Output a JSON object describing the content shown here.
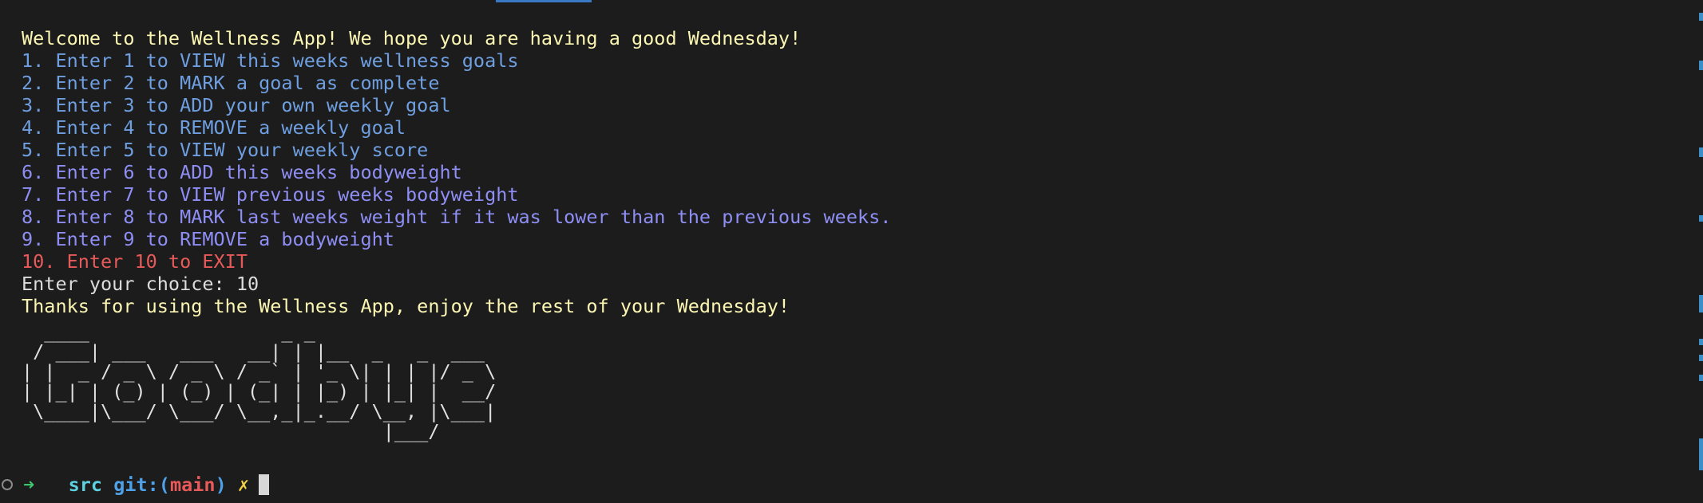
{
  "terminal": {
    "lines": [
      {
        "text": "Welcome to the Wellness App! We hope you are having a good Wednesday!"
      },
      {
        "text": "1. Enter 1 to VIEW this weeks wellness goals"
      },
      {
        "text": "2. Enter 2 to MARK a goal as complete"
      },
      {
        "text": "3. Enter 3 to ADD your own weekly goal"
      },
      {
        "text": "4. Enter 4 to REMOVE a weekly goal"
      },
      {
        "text": "5. Enter 5 to VIEW your weekly score"
      },
      {
        "text": "6. Enter 6 to ADD this weeks bodyweight"
      },
      {
        "text": "7. Enter 7 to VIEW previous weeks bodyweight"
      },
      {
        "text": "8. Enter 8 to MARK last weeks weight if it was lower than the previous weeks."
      },
      {
        "text": "9. Enter 9 to REMOVE a bodyweight"
      },
      {
        "text": "10. Enter 10 to EXIT"
      },
      {
        "text": "Enter your choice: 10"
      },
      {
        "text": "Thanks for using the Wellness App, enjoy the rest of your Wednesday!"
      }
    ],
    "ascii_art": "  ____                 _ _                \n / ___| ___   ___   __| | |__  _   _  ___ \n| |  _ / _ \\ / _ \\ / _` | '_ \\| | | |/ _ \\\n| |_| | (_) | (_) | (_| | |_) | |_| |  __/\n \\____|\\___/ \\___/ \\__,_|_.__/ \\__, |\\___|\n                                |___/     ",
    "prompt": {
      "arrow": "➜",
      "directory": "src",
      "git_label": "git:(",
      "branch": "main",
      "git_close": ")",
      "dirty_marker": "✗"
    }
  },
  "colors": {
    "background": "#1c1c1c",
    "yellow": "#fbf6b2",
    "blue": "#6f9fe0",
    "purple": "#8e8ef5",
    "red": "#e85a5a",
    "prompt_green": "#3ec46d",
    "prompt_cyan": "#5ed1e0",
    "scrollbar_marker": "#3b8ec7"
  }
}
